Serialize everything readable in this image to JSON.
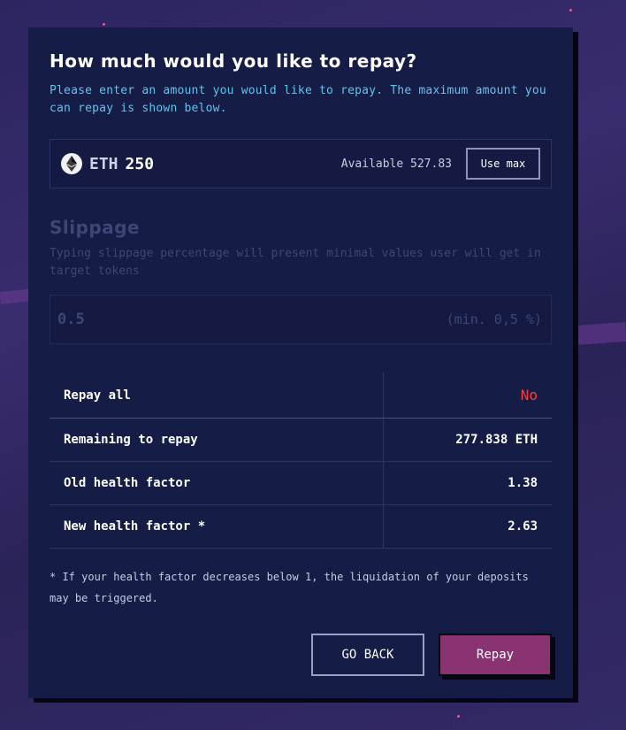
{
  "modal": {
    "title": "How much would you like to repay?",
    "subtitle": "Please enter an amount you would like to repay. The maximum amount you can repay is shown below."
  },
  "amount": {
    "token_icon": "ethereum-icon",
    "token_symbol": "ETH",
    "value": "250",
    "available_text": "Available 527.83",
    "use_max_label": "Use max"
  },
  "slippage": {
    "title": "Slippage",
    "description": "Typing slippage percentage will present minimal values user will get in target tokens",
    "value": "0.5",
    "hint": "(min. 0,5 %)"
  },
  "summary": {
    "rows": [
      {
        "label": "Repay all",
        "value": "No"
      },
      {
        "label": "Remaining to repay",
        "value": "277.838 ETH"
      },
      {
        "label": "Old health factor",
        "value": "1.38"
      },
      {
        "label": "New health factor *",
        "value": "2.63"
      }
    ]
  },
  "footnote": "* If your health factor decreases below 1, the liquidation of your deposits may be triggered.",
  "buttons": {
    "back_label": "GO BACK",
    "repay_label": "Repay"
  },
  "colors": {
    "accent_text": "#5fc4f0",
    "danger": "#ff3c3c",
    "primary_button": "#8a3372",
    "modal_bg": "#151c45"
  }
}
